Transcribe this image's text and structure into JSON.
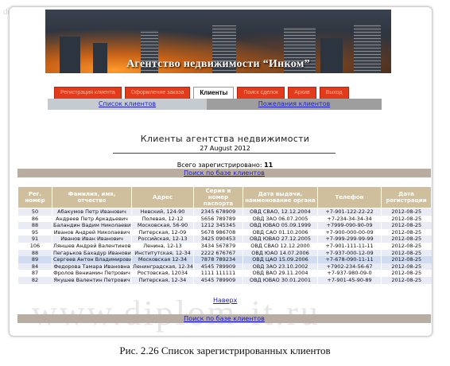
{
  "watermark_top": "diplom-it",
  "watermark_bottom": "www.diplom-it.ru",
  "banner": {
    "title": "Агентство недвижимости “Инком”"
  },
  "nav": [
    {
      "label": "Регистрация клиента",
      "active": false
    },
    {
      "label": "Оформление заказа",
      "active": false
    },
    {
      "label": "Клиенты",
      "active": true
    },
    {
      "label": "Поиск сделок",
      "active": false
    },
    {
      "label": "Архив",
      "active": false
    },
    {
      "label": "Выход",
      "active": false
    }
  ],
  "subnav": {
    "clients": "Список клиентов",
    "wishes": "Пожелания клиентов"
  },
  "heading": {
    "title": "Клиенты агентства недвижимости",
    "date": "27 August 2012",
    "total_label": "Всего зарегистрировано:",
    "total": "11"
  },
  "search_link": "Поиск по базе клиентов",
  "table": {
    "columns": [
      "Рег. номер",
      "Фамилия, имя, отчество",
      "Адрес",
      "Серия и номер паспорта",
      "Дата выдачи, наименование органа",
      "Телефон",
      "Дата регистрации"
    ],
    "rows": [
      [
        "50",
        "Абакумов Петр Иванович",
        "Невский, 124-90",
        "2345 678909",
        "ОВД СВАО, 12.12.2004",
        "+7-901-122-22-22",
        "2012-08-25"
      ],
      [
        "86",
        "Андреев Петр Аркадьевич",
        "Полевая, 12-12",
        "5656 789789",
        "ОВД ЗАО 06.07.2005",
        "+7-234-34-34-34",
        "2012-08-25"
      ],
      [
        "88",
        "Баландин Вадим Николаевич",
        "Московская, 56-90",
        "1212 345345",
        "ОВД ЮВАО 05.09.1999",
        "+7999-090-90-09",
        "2012-08-25"
      ],
      [
        "95",
        "Иванов Андрей Николаевич",
        "Питерская, 12-09",
        "5678 986708",
        "ОВД САО 01.10.2006",
        "+7-900-000-00-09",
        "2012-08-25"
      ],
      [
        "91",
        "Иванов Иван Иванович",
        "Российская, 12-13",
        "3425 090453",
        "ОВД ЮВАО 27.12.2005",
        "+7-999-299-99-99",
        "2012-08-25"
      ],
      [
        "106",
        "Ляншев Андрей Валентинович",
        "Ленина, 12-13",
        "3434 567879",
        "ОВД СВАО 12.12.2000",
        "+7-901-111-11-11",
        "2012-08-25"
      ],
      [
        "88",
        "Пегарьков Бахадур Иванович",
        "Институтская, 12-34",
        "2222 676767",
        "ОВД ЮАО 14.07.2006",
        "+7-937-000-12-09",
        "2012-08-25"
      ],
      [
        "89",
        "Сергеев Антон Владимирович",
        "Московская 12-34",
        "7878 789234",
        "ОВД ЦАО 15.09.2006",
        "+7-678-090-11-11",
        "2012-08-25"
      ],
      [
        "84",
        "Федорова Тамара Ивановна",
        "Ленинградская, 12-345",
        "4545 789909",
        "ОВД ЗАО 23.10.2002",
        "+7902-234-56-67",
        "2012-08-25"
      ],
      [
        "87",
        "Фролов Вениамин Петрович",
        "Ростовская, 12034",
        "1111 111111",
        "ОВД ВАО 29.11.2004",
        "+7-937-980-09-0",
        "2012-08-25"
      ],
      [
        "82",
        "Якушев Валентин Петрович",
        "Питерская, 12-34",
        "4545 789909",
        "ОВД ЮВАО 30.01.2001",
        "+7-901-45-90-89",
        "2012-08-25"
      ]
    ]
  },
  "back_to_top": "Наверх",
  "caption": "Рис.  2.26  Список зарегистрированных клиентов",
  "colors": {
    "nav": "#e23a1a",
    "header": "#cfbf9c",
    "bar": "#b8ada0"
  }
}
